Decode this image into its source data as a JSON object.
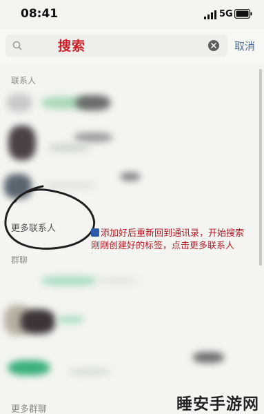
{
  "status_bar": {
    "time": "08:41",
    "network": "5G",
    "icons": [
      "signal-icon",
      "battery-icon"
    ]
  },
  "search": {
    "query": "搜索",
    "cancel_label": "取消",
    "icons": [
      "search-icon",
      "clear-icon"
    ]
  },
  "sections": {
    "contacts_header": "联系人",
    "more_contacts": "更多联系人",
    "groups_header": "群聊",
    "more_groups": "更多群聊"
  },
  "annotation": {
    "note": "添加好后重新回到通讯录，开始搜索刚刚创建好的标签，点击更多联系人",
    "color": "#b11e2a"
  },
  "watermark": "睡安手游网",
  "colors": {
    "accent_link": "#4f6d99",
    "query_text": "#c9222b"
  }
}
